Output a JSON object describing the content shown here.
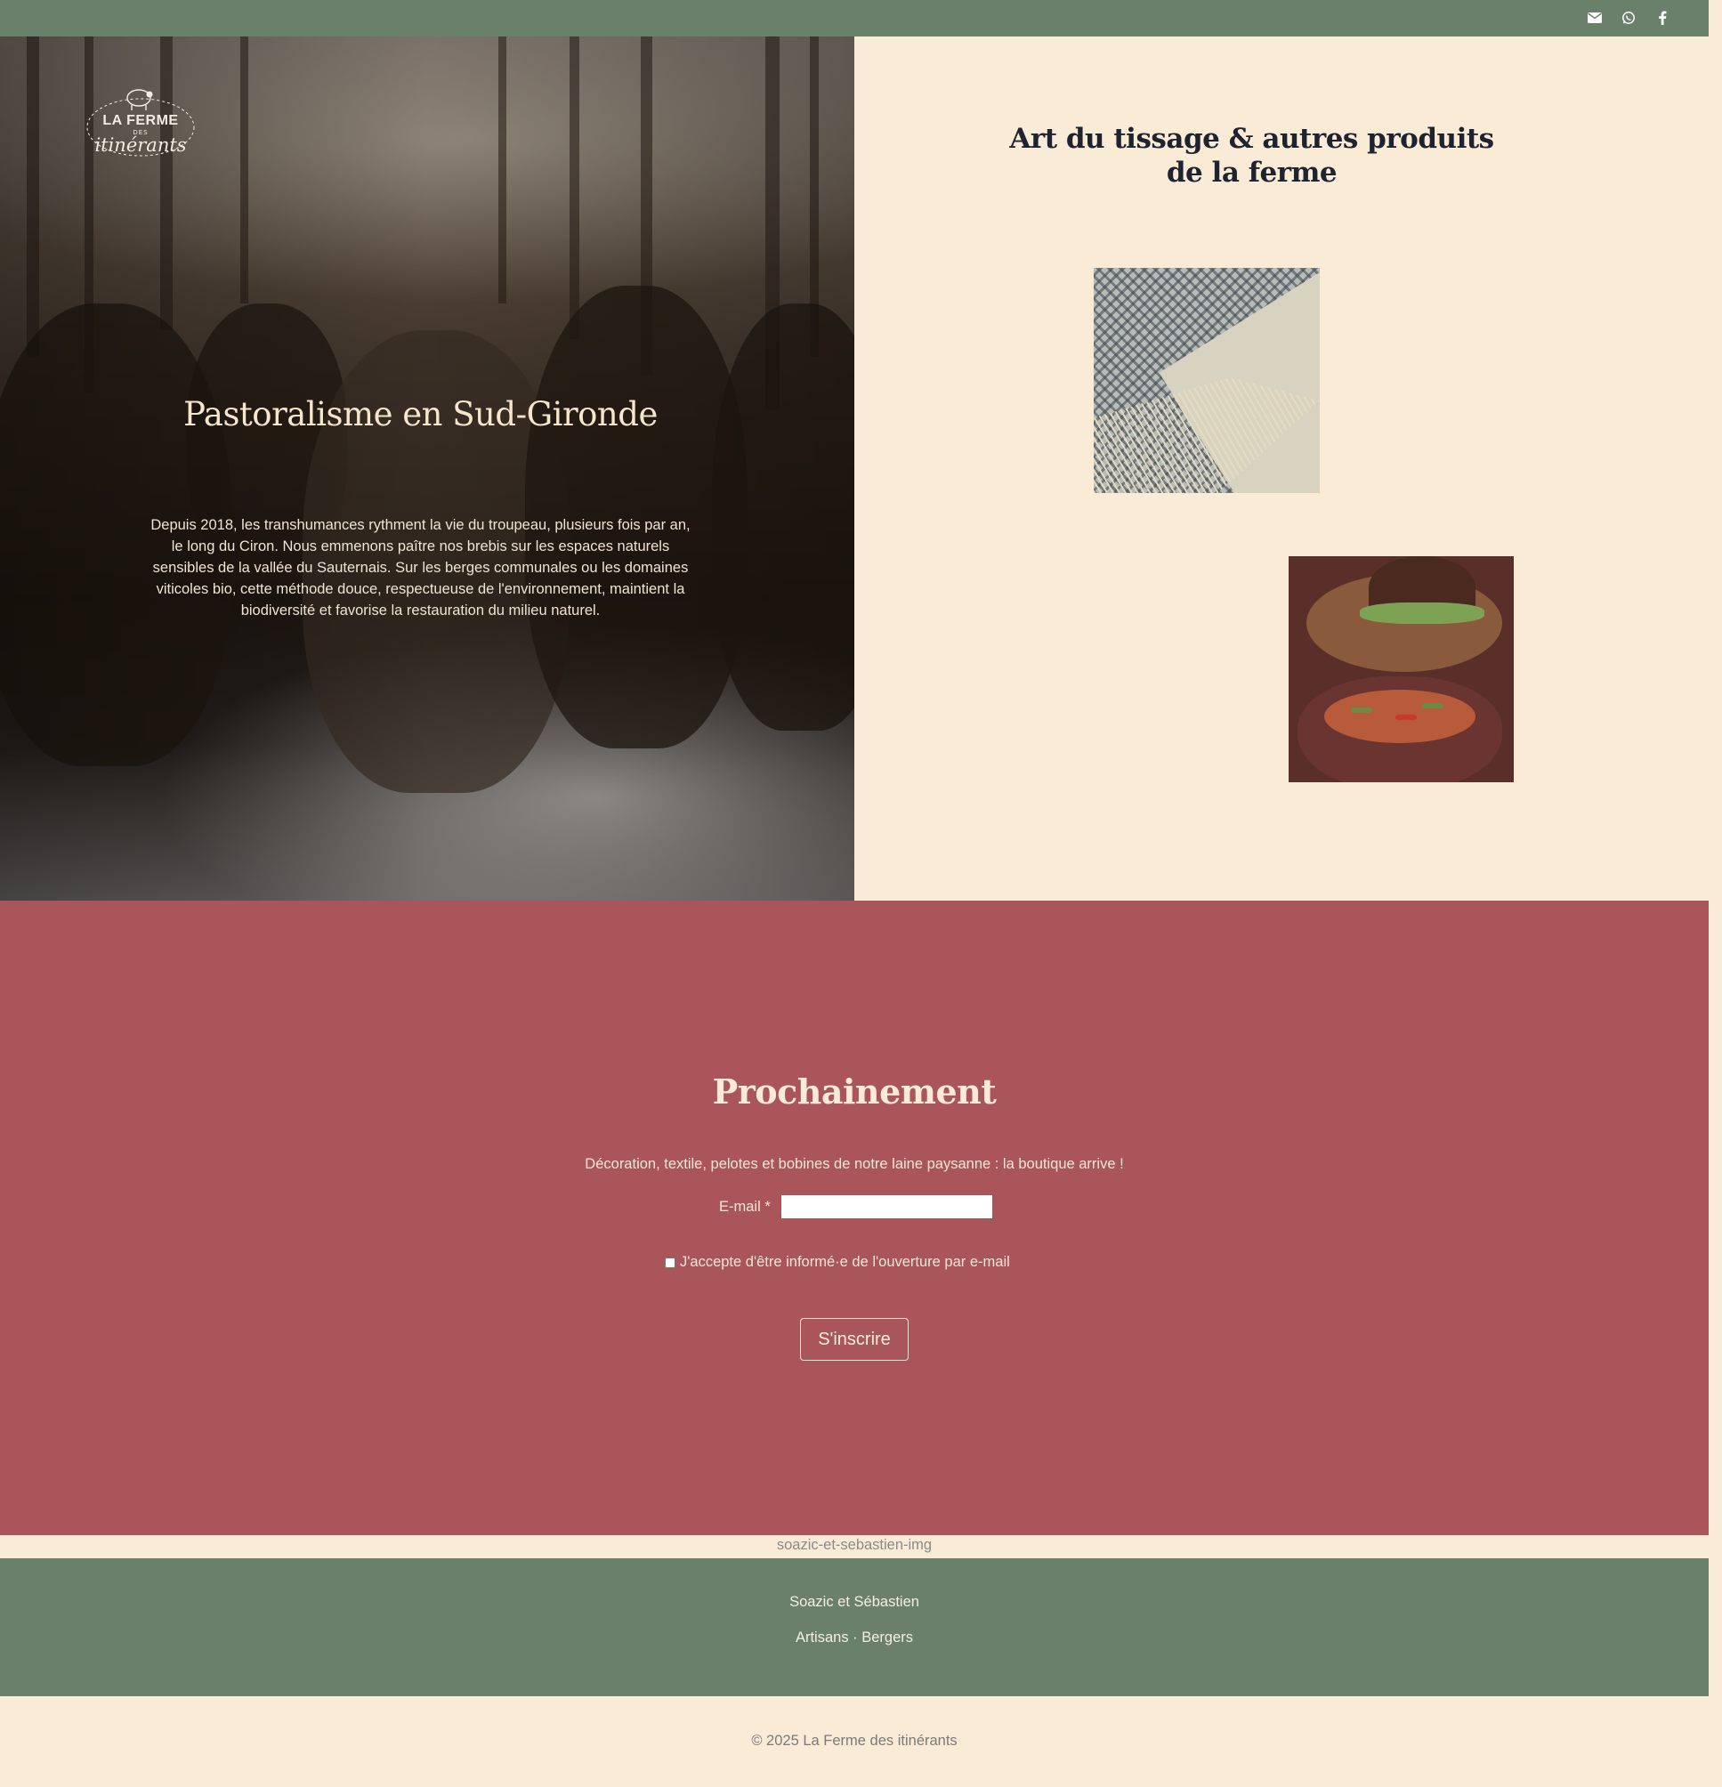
{
  "topbar": {
    "icons": [
      "envelope-icon",
      "whatsapp-icon",
      "facebook-icon"
    ],
    "background": "#6a806b"
  },
  "logo": {
    "line1": "LA FERME",
    "line2": "DES",
    "line3": "itinérants"
  },
  "hero": {
    "title": "Pastoralisme en Sud-Gironde",
    "text": "Depuis 2018, les transhumances rythment la vie du troupeau, plusieurs fois par an, le long du Ciron. Nous emmenons paître nos brebis sur les espaces naturels sensibles de la vallée du Sauternais. Sur les berges communales ou les domaines viticoles bio, cette méthode douce, respectueuse de l'environnement, maintient la biodiversité et favorise la restauration du milieu naturel."
  },
  "products": {
    "title": "Art du tissage & autres produits de la ferme"
  },
  "subscribe": {
    "title": "Prochainement",
    "text": "Décoration, textile, pelotes et bobines de notre laine paysanne : la boutique arrive !",
    "email_label": "E-mail *",
    "email_value": "",
    "consent_label": "J'accepte d'être informé·e de l'ouverture par e-mail",
    "button_label": "S'inscrire",
    "background": "#aa5559"
  },
  "image_alt": "soazic-et-sebastien-img",
  "footer": {
    "name": "Soazic et Sébastien",
    "role": "Artisans · Bergers",
    "copyright": "© 2025 La Ferme des itinérants",
    "background": "#6a806b"
  },
  "page_background": "#faebd7"
}
